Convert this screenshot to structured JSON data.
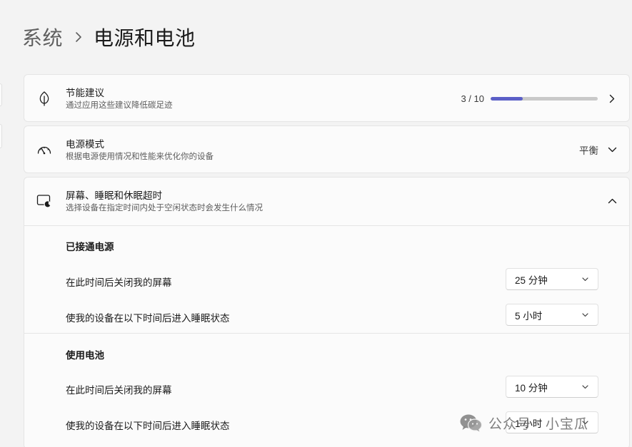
{
  "breadcrumb": {
    "parent": "系统",
    "separator": "›",
    "current": "电源和电池"
  },
  "energy": {
    "title": "节能建议",
    "subtitle": "通过应用这些建议降低碳足迹",
    "progress_text": "3 / 10",
    "progress_fraction": 0.3,
    "icon": "leaf-icon"
  },
  "power_mode": {
    "title": "电源模式",
    "subtitle": "根据电源使用情况和性能来优化你的设备",
    "value": "平衡",
    "icon": "gauge-icon"
  },
  "screen_sleep": {
    "title": "屏幕、睡眠和休眠超时",
    "subtitle": "选择设备在指定时间内处于空闲状态时会发生什么情况",
    "icon": "screen-sleep-icon",
    "plugged_in": {
      "heading": "已接通电源",
      "screen_off_label": "在此时间后关闭我的屏幕",
      "screen_off_value": "25 分钟",
      "sleep_label": "使我的设备在以下时间后进入睡眠状态",
      "sleep_value": "5 小时"
    },
    "battery": {
      "heading": "使用电池",
      "screen_off_label": "在此时间后关闭我的屏幕",
      "screen_off_value": "10 分钟",
      "sleep_label": "使我的设备在以下时间后进入睡眠状态",
      "sleep_value": "1 小时"
    }
  },
  "watermark": {
    "text": "公众号 · 小宝瓜",
    "icon": "wechat-icon"
  },
  "colors": {
    "accent": "#5b5fc7",
    "background": "#f3f3f3",
    "card": "#fbfbfb"
  }
}
